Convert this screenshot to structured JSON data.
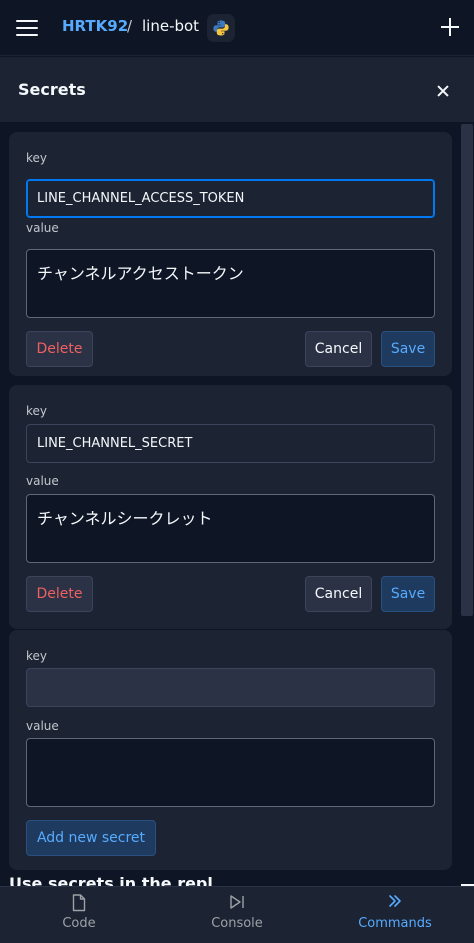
{
  "topbar": {
    "user": "HRTK92",
    "separator": "/",
    "repl_name": "line-bot",
    "language_icon": "python-icon"
  },
  "pane": {
    "title": "Secrets"
  },
  "secrets": [
    {
      "key_label": "key",
      "key_value": "LINE_CHANNEL_ACCESS_TOKEN",
      "value_label": "value",
      "value_text": "チャンネルアクセストークン",
      "delete_label": "Delete",
      "cancel_label": "Cancel",
      "save_label": "Save"
    },
    {
      "key_label": "key",
      "key_value": "LINE_CHANNEL_SECRET",
      "value_label": "value",
      "value_text": "チャンネルシークレット",
      "delete_label": "Delete",
      "cancel_label": "Cancel",
      "save_label": "Save"
    }
  ],
  "new_secret": {
    "key_label": "key",
    "key_value": "",
    "value_label": "value",
    "value_text": "",
    "add_label": "Add new secret"
  },
  "bottom_heading": "Use secrets in the repl",
  "bottom_nav": {
    "items": [
      {
        "label": "Code",
        "icon": "file-icon"
      },
      {
        "label": "Console",
        "icon": "play-step-icon"
      },
      {
        "label": "Commands",
        "icon": "double-chevron-right-icon"
      }
    ],
    "active": "Commands"
  },
  "colors": {
    "background": "#0e1525",
    "surface": "#1c2333",
    "accent": "#57abff",
    "danger": "#f06060"
  }
}
